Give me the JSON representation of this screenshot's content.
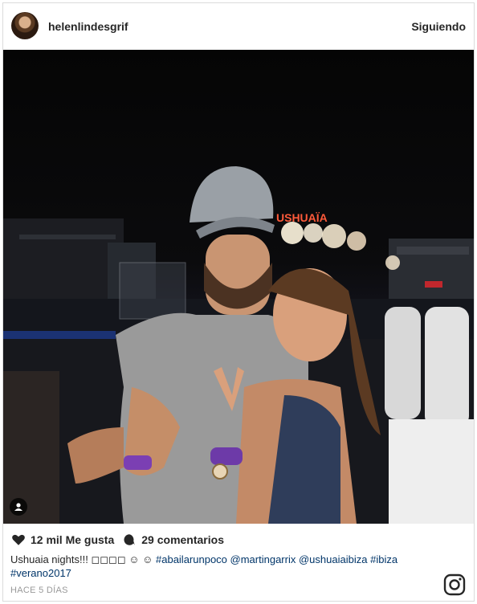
{
  "header": {
    "username": "helenlindesgrif",
    "follow_label": "Siguiendo"
  },
  "photo": {
    "sign_text": "USHUAÏA"
  },
  "actions": {
    "likes": "12 mil Me gusta",
    "comments": "29 comentarios"
  },
  "caption": {
    "text": "Ushuaia nights!!! ◻◻◻◻ ☺ ☺ ",
    "hashtag1": "#abailarunpoco",
    "mention1": "@martingarrix",
    "mention2": "@ushuaiaibiza",
    "hashtag2": "#ibiza",
    "hashtag3": "#verano2017"
  },
  "timestamp": "HACE 5 DÍAS",
  "icons": {
    "like": "heart-icon",
    "comment": "comment-icon",
    "tag": "user-tag-icon",
    "brand": "instagram-logo-icon"
  }
}
